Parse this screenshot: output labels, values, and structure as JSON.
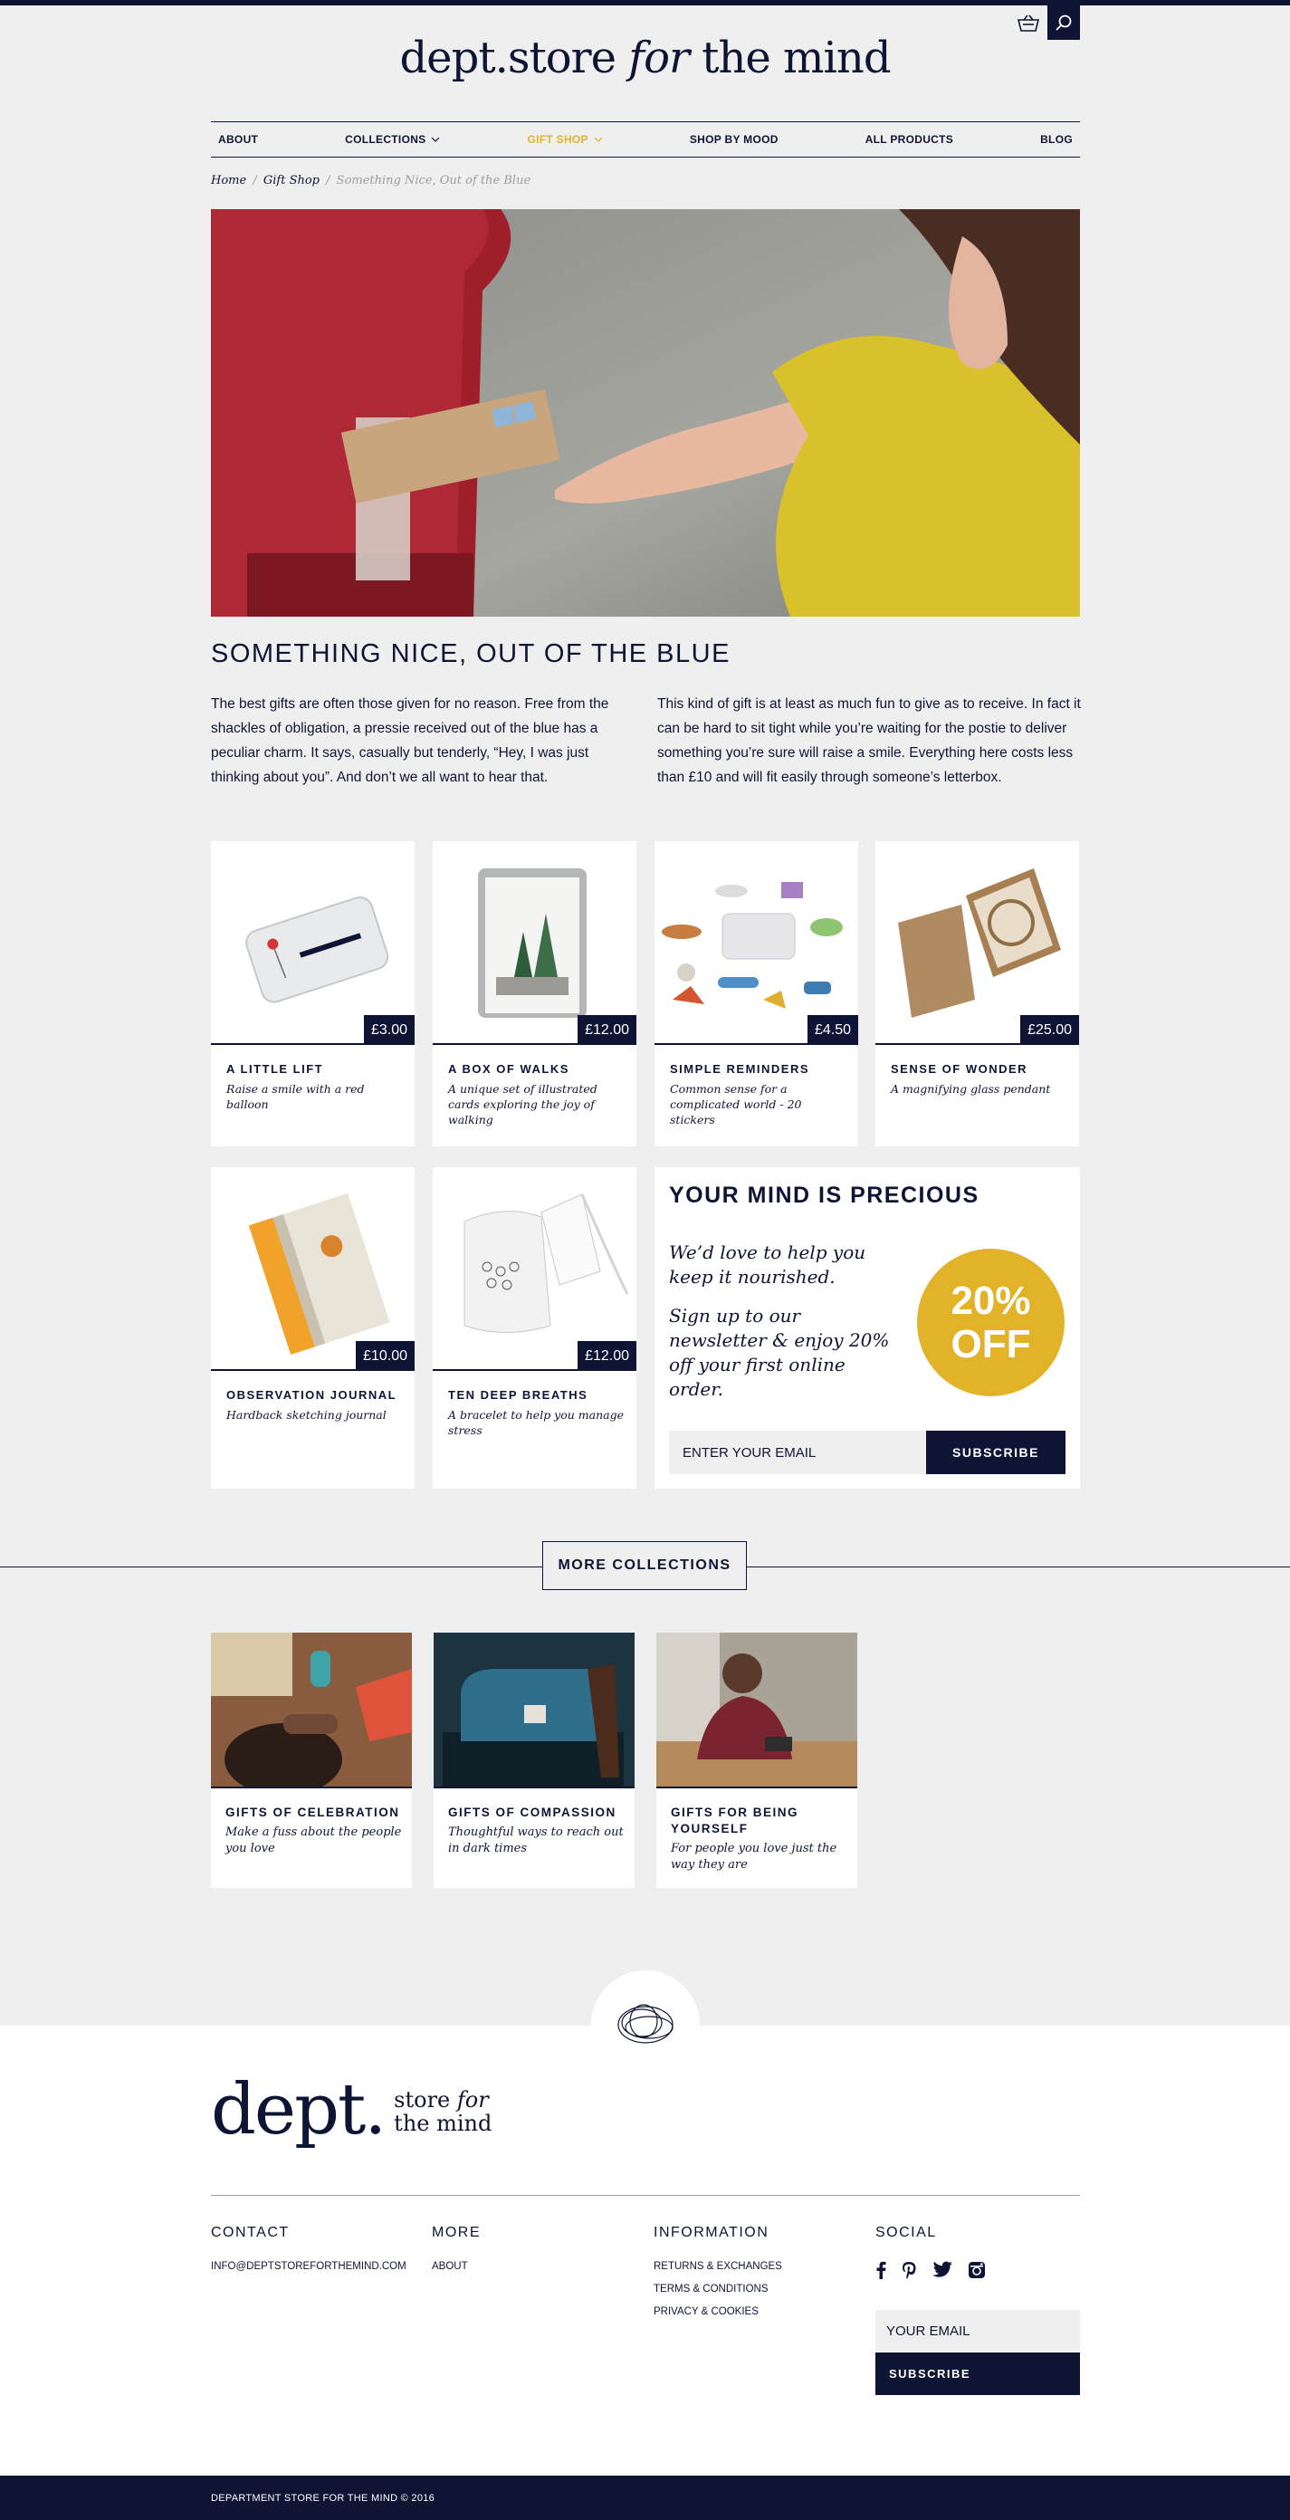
{
  "site": {
    "logo_main": "dept.store",
    "logo_italic": "for",
    "logo_end": "the mind"
  },
  "nav": {
    "items": [
      {
        "label": "ABOUT"
      },
      {
        "label": "COLLECTIONS"
      },
      {
        "label": "GIFT SHOP"
      },
      {
        "label": "SHOP BY MOOD"
      },
      {
        "label": "ALL PRODUCTS"
      },
      {
        "label": "BLOG"
      }
    ],
    "active": "GIFT SHOP",
    "accent_color": "#e2b228"
  },
  "breadcrumb": {
    "home": "Home",
    "sep1": "/",
    "parent": "Gift Shop",
    "sep2": "/",
    "current": "Something Nice, Out of the Blue"
  },
  "page": {
    "title": "SOMETHING NICE, OUT OF THE BLUE",
    "intro_left": "The best gifts are often those given for no reason. Free from the shackles of obligation, a pressie received out of the blue has a peculiar charm. It says, casually but tenderly, “Hey, I was just thinking about you”. And don’t we all want to hear that.",
    "intro_right": "This kind of gift is at least as much fun to give as to receive. In fact it can be hard to sit tight while you’re waiting for the postie to deliver something you’re sure will raise a smile. Everything here costs less than £10 and will fit easily through someone’s letterbox."
  },
  "products": [
    {
      "name": "A LITTLE LIFT",
      "desc": "Raise a smile with a red balloon",
      "price": "£3.00"
    },
    {
      "name": "A BOX OF WALKS",
      "desc": "A unique set of illustrated cards exploring the joy of walking",
      "price": "£12.00"
    },
    {
      "name": "SIMPLE REMINDERS",
      "desc": "Common sense for a complicated world - 20 stickers",
      "price": "£4.50"
    },
    {
      "name": "SENSE OF WONDER",
      "desc": "A magnifying glass pendant",
      "price": "£25.00"
    },
    {
      "name": "OBSERVATION JOURNAL",
      "desc": "Hardback sketching journal",
      "price": "£10.00"
    },
    {
      "name": "TEN DEEP BREATHS",
      "desc": "A bracelet to help you manage stress",
      "price": "£12.00"
    }
  ],
  "newsletter": {
    "heading": "YOUR MIND IS PRECIOUS",
    "line1": "We’d love to help you keep it nourished.",
    "line2": "Sign up to our newsletter & enjoy 20% off your first online order.",
    "badge_top": "20%",
    "badge_bottom": "OFF",
    "email_placeholder": "ENTER YOUR EMAIL",
    "subscribe": "SUBSCRIBE"
  },
  "more_collections": {
    "button": "MORE COLLECTIONS",
    "items": [
      {
        "name": "GIFTS OF CELEBRATION",
        "desc": "Make a fuss about the people you love"
      },
      {
        "name": "GIFTS OF COMPASSION",
        "desc": "Thoughtful ways to reach out in dark times"
      },
      {
        "name": "GIFTS FOR BEING YOURSELF",
        "desc": "For people you love just the way they are"
      }
    ]
  },
  "footer": {
    "logo_big": "dept.",
    "logo_small_1": "store",
    "logo_small_italic": "for",
    "logo_small_2": "the mind",
    "contact": {
      "heading": "CONTACT",
      "email": "INFO@DEPTSTOREFORTHEMIND.COM"
    },
    "more": {
      "heading": "MORE",
      "links": [
        "ABOUT"
      ]
    },
    "information": {
      "heading": "INFORMATION",
      "links": [
        "RETURNS & EXCHANGES",
        "TERMS & CONDITIONS",
        "PRIVACY & COOKIES"
      ]
    },
    "social": {
      "heading": "SOCIAL",
      "icons": [
        "facebook-icon",
        "pinterest-icon",
        "twitter-icon",
        "instagram-icon"
      ]
    },
    "email_placeholder": "YOUR EMAIL",
    "subscribe": "SUBSCRIBE",
    "copyright": "DEPARTMENT STORE FOR THE MIND © 2016"
  },
  "colors": {
    "navy": "#0e1434",
    "yellow": "#e2b228",
    "background": "#efefef"
  }
}
